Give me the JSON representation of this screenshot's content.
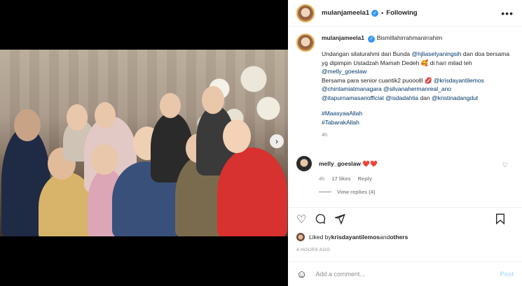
{
  "post": {
    "username": "mulanjameela1",
    "follow_status": "Following",
    "more_label": "•••"
  },
  "caption": {
    "username": "mulanjameela1",
    "first_line": "Bismillahirrahmanirrahim",
    "p1_a": "Undangan silaturahmi dari Bunda ",
    "p1_mention": "@hjliasetyaningsih",
    "p1_b": " dan doa bersama yg dipimpin Ustadzah Mamah Dedeh 🥰 di hari milad teh ",
    "p1_mention2": "@melly_goeslaw",
    "p2_a": "Bersama para senior cuantik2 puooolll 💋 ",
    "m_krisdayanti": "@krisdayantilemos",
    "m_chintami": "@chintamiatmanagara",
    "m_silvana": "@silvanahermanreal_ano",
    "m_itapurnamasari": "@itapurnamasariofficial",
    "m_isdadahlia": "@isdadahlia",
    "dan": " dan ",
    "m_kristina": "@kristinadangdut",
    "tag1": "#MaasyaaAllah",
    "tag2": "#TabarakAllah",
    "time": "4h"
  },
  "comment": {
    "username": "melly_goeslaw",
    "text": "❤️❤️",
    "time": "4h",
    "likes": "17 likes",
    "reply": "Reply",
    "view_replies": "View replies (4)"
  },
  "likes_line": {
    "prefix": "Liked by ",
    "user": "krisdayantilemos",
    "and": " and ",
    "others": "others"
  },
  "post_time": "4 HOURS AGO",
  "add_comment": {
    "placeholder": "Add a comment...",
    "post_label": "Post"
  },
  "icons": {
    "verified": "✓",
    "next": "›"
  }
}
